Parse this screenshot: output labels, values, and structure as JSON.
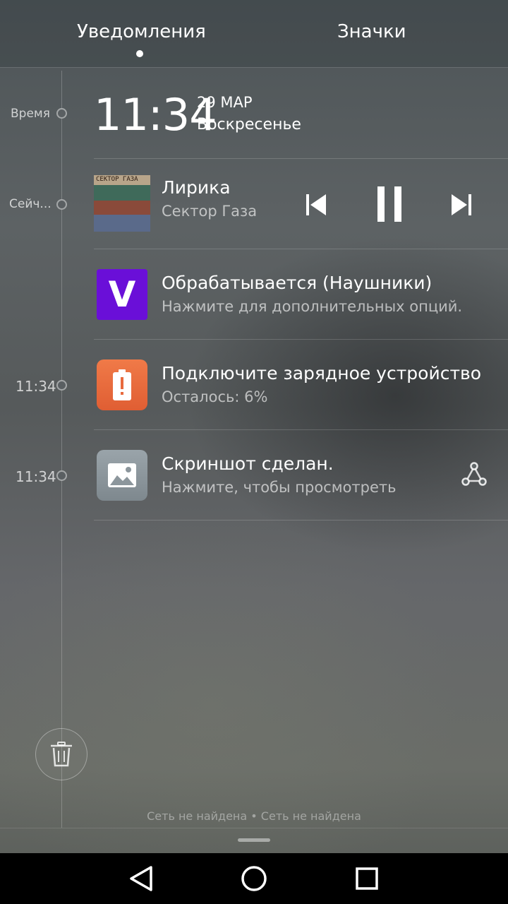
{
  "tabs": {
    "notifications_label": "Уведомления",
    "icons_label": "Значки"
  },
  "timeline": {
    "label_time": "Время",
    "label_now": "Сейч...",
    "label_battery_time": "11:34",
    "label_screenshot_time": "11:34"
  },
  "clock": {
    "time": "11:34",
    "date": "29 МАР",
    "weekday": "Воскресенье"
  },
  "media": {
    "title": "Лирика",
    "artist": "Сектор Газа",
    "album_text": "СЕКТОР ГАЗА"
  },
  "notifications": [
    {
      "title": "Обрабатывается (Наушники)",
      "subtitle": "Нажмите для дополнительных опций.",
      "icon": "v-app-icon",
      "icon_letter": "V",
      "color": "#6a0fd8"
    },
    {
      "title": "Подключите зарядное устройство",
      "subtitle": "Осталось: 6%",
      "icon": "battery-alert-icon",
      "color": "#e86a3e"
    },
    {
      "title": "Скриншот сделан.",
      "subtitle": "Нажмите, чтобы просмотреть",
      "icon": "gallery-icon",
      "action_icon": "share-icon",
      "color": "#8c969c"
    }
  ],
  "footer": {
    "network_status": "Сеть не найдена • Сеть не найдена"
  }
}
